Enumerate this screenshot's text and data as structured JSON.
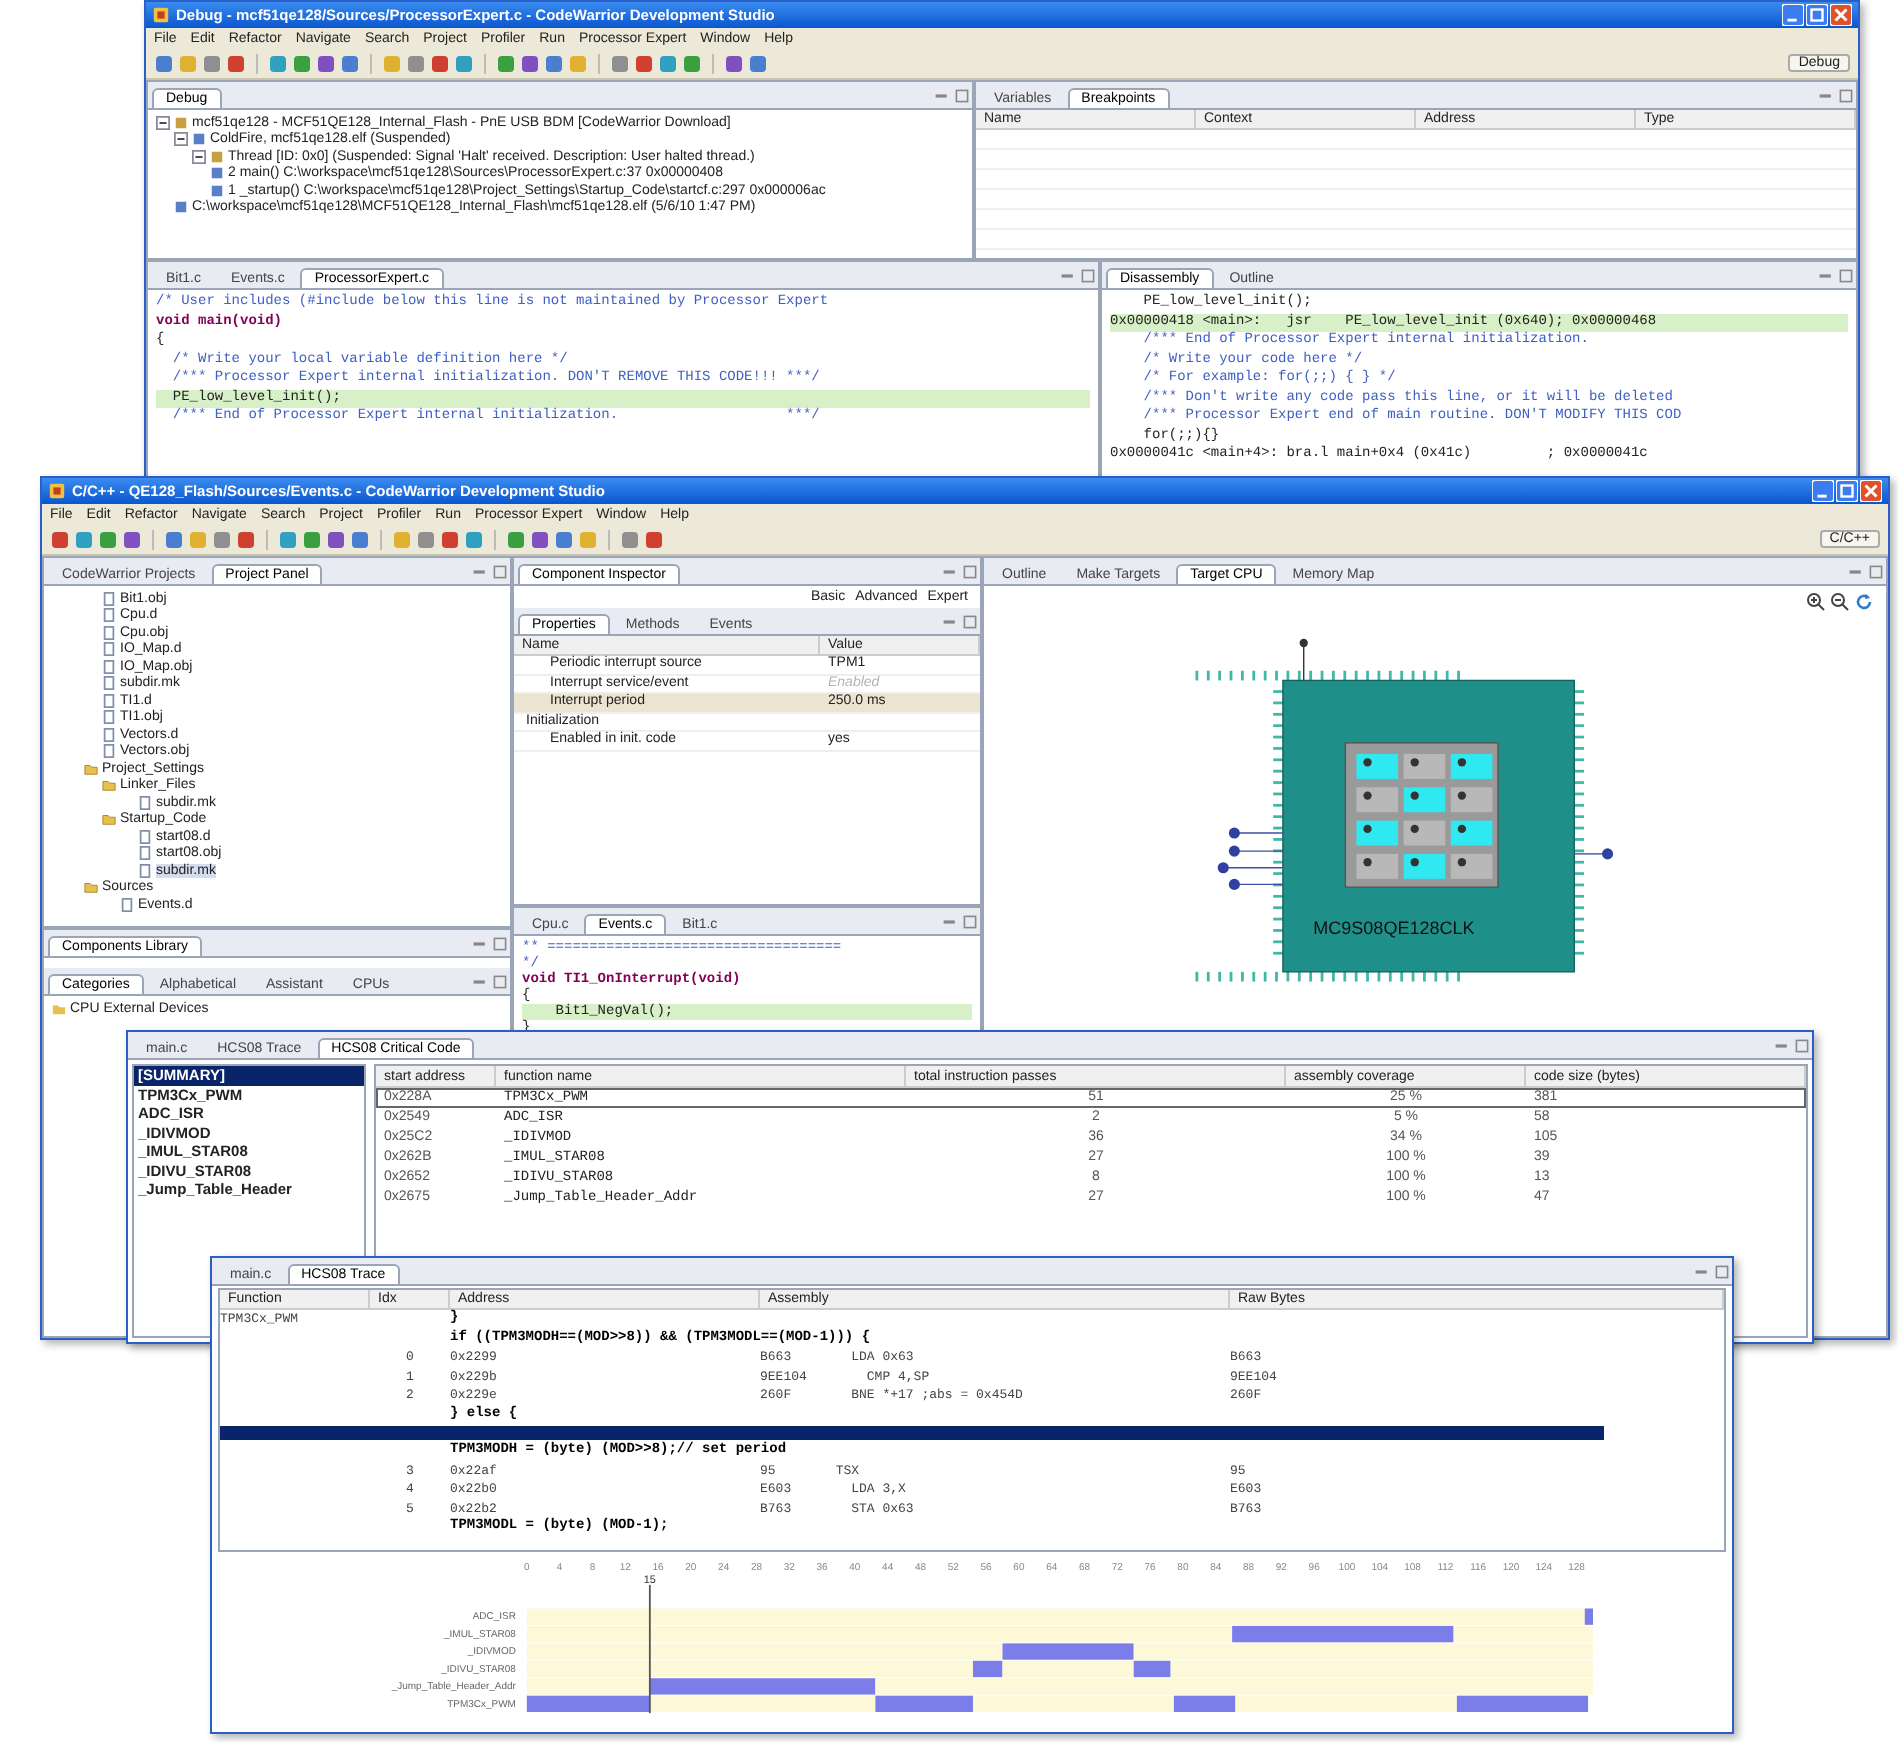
{
  "debug_window": {
    "title": "Debug - mcf51qe128/Sources/ProcessorExpert.c - CodeWarrior Development Studio",
    "menu": [
      "File",
      "Edit",
      "Refactor",
      "Navigate",
      "Search",
      "Project",
      "Profiler",
      "Run",
      "Processor Expert",
      "Window",
      "Help"
    ],
    "perspective": "Debug",
    "debug_view": {
      "tab": "Debug",
      "tree": [
        {
          "label": "mcf51qe128 - MCF51QE128_Internal_Flash - PnE USB BDM [CodeWarrior Download]",
          "children": [
            {
              "label": "ColdFire, mcf51qe128.elf (Suspended)",
              "children": [
                {
                  "label": "Thread [ID: 0x0] (Suspended: Signal 'Halt' received. Description: User halted thread.)",
                  "children": [
                    {
                      "label": "2 main() C:\\workspace\\mcf51qe128\\Sources\\ProcessorExpert.c:37 0x00000408"
                    },
                    {
                      "label": "1 _startup() C:\\workspace\\mcf51qe128\\Project_Settings\\Startup_Code\\startcf.c:297 0x000006ac"
                    }
                  ]
                }
              ]
            },
            {
              "label": "C:\\workspace\\mcf51qe128\\MCF51QE128_Internal_Flash\\mcf51qe128.elf (5/6/10 1:47 PM)"
            }
          ]
        }
      ]
    },
    "breakpoints_view": {
      "tabs": [
        {
          "label": "Variables",
          "selected": false
        },
        {
          "label": "Breakpoints",
          "selected": true
        }
      ],
      "columns": [
        "Name",
        "Context",
        "Address",
        "Type"
      ]
    },
    "editor": {
      "tabs": [
        {
          "label": "Bit1.c",
          "selected": false
        },
        {
          "label": "Events.c",
          "selected": false
        },
        {
          "label": "ProcessorExpert.c",
          "selected": true
        }
      ],
      "lines": [
        {
          "kind": "comment",
          "text": "/* User includes (#include below this line is not maintained by Processor Expert"
        },
        {
          "kind": "bold",
          "text": "void main(void)"
        },
        {
          "kind": "code",
          "text": "{"
        },
        {
          "kind": "comment",
          "text": "  /* Write your local variable definition here */"
        },
        {
          "kind": "comment",
          "text": "  /*** Processor Expert internal initialization. DON'T REMOVE THIS CODE!!! ***/"
        },
        {
          "kind": "current",
          "text": "  PE_low_level_init();"
        },
        {
          "kind": "comment",
          "text": "  /*** End of Processor Expert internal initialization.                    ***/"
        }
      ]
    },
    "disassembly": {
      "tabs": [
        {
          "label": "Disassembly",
          "selected": true
        },
        {
          "label": "Outline",
          "selected": false
        }
      ],
      "lines": [
        {
          "kind": "code",
          "text": "    PE_low_level_init();"
        },
        {
          "kind": "current",
          "text": "0x00000418 <main>:   jsr    PE_low_level_init (0x640); 0x00000468"
        },
        {
          "kind": "comment",
          "text": "    /*** End of Processor Expert internal initialization."
        },
        {
          "kind": "comment",
          "text": "    /* Write your code here */"
        },
        {
          "kind": "comment",
          "text": "    /* For example: for(;;) { } */"
        },
        {
          "kind": "comment",
          "text": "    /*** Don't write any code pass this line, or it will be deleted"
        },
        {
          "kind": "comment",
          "text": "    /*** Processor Expert end of main routine. DON'T MODIFY THIS COD"
        },
        {
          "kind": "code",
          "text": "    for(;;){}"
        },
        {
          "kind": "code",
          "text": "0x0000041c <main+4>: bra.l main+0x4 (0x41c)         ; 0x0000041c"
        }
      ]
    }
  },
  "cc_window": {
    "title": "C/C++ - QE128_Flash/Sources/Events.c - CodeWarrior Development Studio",
    "menu": [
      "File",
      "Edit",
      "Refactor",
      "Navigate",
      "Search",
      "Project",
      "Profiler",
      "Run",
      "Processor Expert",
      "Window",
      "Help"
    ],
    "perspective": "C/C++",
    "project_view": {
      "tabs": [
        {
          "label": "CodeWarrior Projects",
          "selected": false
        },
        {
          "label": "Project Panel",
          "selected": true
        }
      ],
      "tree": [
        {
          "label": "Bit1.obj",
          "selected": false
        },
        {
          "label": "Cpu.d",
          "selected": false
        },
        {
          "label": "Cpu.obj",
          "selected": false
        },
        {
          "label": "IO_Map.d",
          "selected": false
        },
        {
          "label": "IO_Map.obj",
          "selected": false
        },
        {
          "label": "subdir.mk",
          "selected": false
        },
        {
          "label": "TI1.d",
          "selected": false
        },
        {
          "label": "TI1.obj",
          "selected": false
        },
        {
          "label": "Vectors.d",
          "selected": false
        },
        {
          "label": "Vectors.obj",
          "selected": false
        },
        {
          "label": "Project_Settings",
          "selected": false,
          "children": [
            {
              "label": "Linker_Files",
              "selected": false,
              "children": [
                {
                  "label": "subdir.mk",
                  "selected": false
                }
              ]
            },
            {
              "label": "Startup_Code",
              "selected": false,
              "children": [
                {
                  "label": "start08.d",
                  "selected": false
                },
                {
                  "label": "start08.obj",
                  "selected": false
                },
                {
                  "label": "subdir.mk",
                  "selected": true
                }
              ]
            }
          ]
        },
        {
          "label": "Sources",
          "selected": false,
          "children": [
            {
              "label": "Events.d",
              "selected": false
            }
          ]
        }
      ]
    },
    "library": {
      "tab": "Components Library",
      "tabs": [
        {
          "label": "Categories",
          "selected": true
        },
        {
          "label": "Alphabetical",
          "selected": false
        },
        {
          "label": "Assistant",
          "selected": false
        },
        {
          "label": "CPUs",
          "selected": false
        }
      ],
      "items": [
        "CPU External Devices"
      ]
    },
    "inspector": {
      "tab": "Component Inspector",
      "modes": [
        "Basic",
        "Advanced",
        "Expert"
      ],
      "tabs": [
        {
          "label": "Properties",
          "selected": true
        },
        {
          "label": "Methods",
          "selected": false
        },
        {
          "label": "Events",
          "selected": false
        }
      ],
      "columns": [
        "Name",
        "Value"
      ],
      "rows": [
        {
          "kind": "property",
          "name": "Periodic interrupt source",
          "value": "TPM1",
          "selected": false,
          "disabled": false
        },
        {
          "kind": "property",
          "name": "Interrupt service/event",
          "value": "Enabled",
          "selected": false,
          "disabled": true
        },
        {
          "kind": "property",
          "name": "Interrupt period",
          "value": "250.0 ms",
          "selected": true,
          "disabled": false
        },
        {
          "kind": "group",
          "name": "Initialization",
          "selected": false
        },
        {
          "kind": "property",
          "name": "Enabled in init. code",
          "value": "yes",
          "selected": false,
          "disabled": false
        }
      ]
    },
    "editor": {
      "tabs": [
        {
          "label": "Cpu.c",
          "selected": false
        },
        {
          "label": "Events.c",
          "selected": true
        },
        {
          "label": "Bit1.c",
          "selected": false
        }
      ],
      "lines": [
        {
          "kind": "comment",
          "text": "** ==================================="
        },
        {
          "kind": "comment",
          "text": "*/"
        },
        {
          "kind": "bold",
          "text": "void TI1_OnInterrupt(void)"
        },
        {
          "kind": "code",
          "text": "{"
        },
        {
          "kind": "current",
          "text": "    Bit1_NegVal();"
        },
        {
          "kind": "code",
          "text": "}"
        }
      ]
    },
    "target_view": {
      "tabs": [
        {
          "label": "Outline",
          "selected": false
        },
        {
          "label": "Make Targets",
          "selected": false
        },
        {
          "label": "Target CPU",
          "selected": true
        },
        {
          "label": "Memory Map",
          "selected": false
        }
      ],
      "chip_label": "MC9S08QE128CLK"
    }
  },
  "critical_code_window": {
    "tabs": [
      {
        "label": "main.c",
        "selected": false
      },
      {
        "label": "HCS08 Trace",
        "selected": false
      },
      {
        "label": "HCS08 Critical Code",
        "selected": true
      }
    ],
    "functions": [
      {
        "label": "[SUMMARY]",
        "selected": true
      },
      {
        "label": "TPM3Cx_PWM",
        "selected": false
      },
      {
        "label": "ADC_ISR",
        "selected": false
      },
      {
        "label": "_IDIVMOD",
        "selected": false
      },
      {
        "label": "_IMUL_STAR08",
        "selected": false
      },
      {
        "label": "_IDIVU_STAR08",
        "selected": false
      },
      {
        "label": "_Jump_Table_Header",
        "selected": false
      }
    ],
    "columns": [
      "start address",
      "function name",
      "total instruction passes",
      "assembly coverage",
      "code size (bytes)"
    ],
    "rows": [
      {
        "cells": [
          "0x228A",
          "TPM3Cx_PWM",
          "51",
          "25 %",
          "381"
        ],
        "selected": true
      },
      {
        "cells": [
          "0x2549",
          "ADC_ISR",
          "2",
          "5 %",
          "58"
        ],
        "selected": false
      },
      {
        "cells": [
          "0x25C2",
          "_IDIVMOD",
          "36",
          "34 %",
          "105"
        ],
        "selected": false
      },
      {
        "cells": [
          "0x262B",
          "_IMUL_STAR08",
          "27",
          "100 %",
          "39"
        ],
        "selected": false
      },
      {
        "cells": [
          "0x2652",
          "_IDIVU_STAR08",
          "8",
          "100 %",
          "13"
        ],
        "selected": false
      },
      {
        "cells": [
          "0x2675",
          "_Jump_Table_Header_Addr",
          "27",
          "100 %",
          "47"
        ],
        "selected": false
      }
    ]
  },
  "trace_window": {
    "tabs": [
      {
        "label": "main.c",
        "selected": false
      },
      {
        "label": "HCS08 Trace",
        "selected": true
      }
    ],
    "columns": [
      "Function",
      "Idx",
      "Address",
      "Assembly",
      "Raw Bytes"
    ],
    "rows": [
      {
        "kind": "source",
        "function": "TPM3Cx_PWM",
        "code": "}"
      },
      {
        "kind": "source",
        "code": "if ((TPM3MODH==(MOD>>8)) && (TPM3MODL==(MOD-1))) {"
      },
      {
        "kind": "instruction",
        "idx": "0",
        "address": "0x2299",
        "opcode": "B663",
        "instruction": "LDA 0x63",
        "raw": "B663"
      },
      {
        "kind": "instruction",
        "idx": "1",
        "address": "0x229b",
        "opcode": "9EE104",
        "instruction": "CMP 4,SP",
        "raw": "9EE104"
      },
      {
        "kind": "instruction",
        "idx": "2",
        "address": "0x229e",
        "opcode": "260F",
        "instruction": "BNE *+17 ;abs = 0x454D",
        "raw": "260F"
      },
      {
        "kind": "source",
        "code": "} else {"
      },
      {
        "kind": "marker"
      },
      {
        "kind": "source",
        "code": "TPM3MODH = (byte) (MOD>>8);// set period"
      },
      {
        "kind": "instruction",
        "idx": "3",
        "address": "0x22af",
        "opcode": "95",
        "instruction": "TSX",
        "raw": "95"
      },
      {
        "kind": "instruction",
        "idx": "4",
        "address": "0x22b0",
        "opcode": "E603",
        "instruction": "LDA 3,X",
        "raw": "E603"
      },
      {
        "kind": "instruction",
        "idx": "5",
        "address": "0x22b2",
        "opcode": "B763",
        "instruction": "STA 0x63",
        "raw": "B763"
      },
      {
        "kind": "source",
        "code": "TPM3MODL = (byte) (MOD-1);"
      }
    ],
    "timeline": {
      "chart_data": {
        "type": "bar",
        "orientation": "horizontal",
        "stacked": true,
        "ref_lines": [
          {
            "axis": "x",
            "value": 15,
            "label": "15"
          }
        ],
        "categories": [
          "ADC_ISR",
          "_IMUL_STAR08",
          "_IDIVMOD",
          "_IDIVU_STAR08",
          "_Jump_Table_Header_Addr",
          "TPM3Cx_PWM"
        ],
        "xticks": [
          0,
          4,
          8,
          12,
          16,
          20,
          24,
          28,
          32,
          36,
          40,
          44,
          48,
          52,
          56,
          60,
          64,
          68,
          72,
          76,
          80,
          84,
          88,
          92,
          96,
          100,
          104,
          108,
          112,
          116,
          120,
          124,
          128
        ],
        "xlim": [
          0,
          130
        ],
        "series": [
          {
            "color": "#fdf8d8",
            "values": [
              129,
              86,
              58,
              54.4,
              15,
              null
            ]
          },
          {
            "color": "#7b7de8",
            "values": [
              1,
              27,
              16,
              3.6,
              27.5,
              15
            ]
          },
          {
            "color": "#fdf8d8",
            "values": [
              null,
              17,
              56,
              16,
              87.5,
              27.5
            ]
          },
          {
            "color": "#7b7de8",
            "values": [
              null,
              null,
              null,
              4.5,
              null,
              11.9
            ]
          },
          {
            "color": "#fdf8d8",
            "values": [
              null,
              null,
              null,
              51.5,
              null,
              24.5
            ]
          },
          {
            "color": "#7b7de8",
            "values": [
              null,
              null,
              null,
              null,
              null,
              7.5
            ]
          },
          {
            "color": "#fdf8d8",
            "values": [
              null,
              null,
              null,
              null,
              null,
              27
            ]
          },
          {
            "color": "#7b7de8",
            "values": [
              null,
              null,
              null,
              null,
              null,
              16
            ]
          }
        ]
      }
    }
  }
}
